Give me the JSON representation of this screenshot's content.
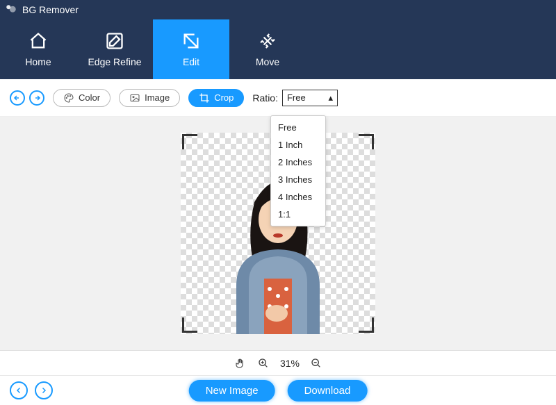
{
  "app": {
    "title": "BG Remover"
  },
  "nav": {
    "items": [
      {
        "label": "Home"
      },
      {
        "label": "Edge Refine"
      },
      {
        "label": "Edit"
      },
      {
        "label": "Move"
      }
    ],
    "active_index": 2
  },
  "toolbar": {
    "color_label": "Color",
    "image_label": "Image",
    "crop_label": "Crop",
    "ratio_label": "Ratio:",
    "ratio_selected": "Free",
    "ratio_options": [
      "Free",
      "1 Inch",
      "2 Inches",
      "3 Inches",
      "4 Inches",
      "1:1"
    ]
  },
  "zoom": {
    "value": "31%"
  },
  "footer": {
    "new_image_label": "New Image",
    "download_label": "Download"
  }
}
